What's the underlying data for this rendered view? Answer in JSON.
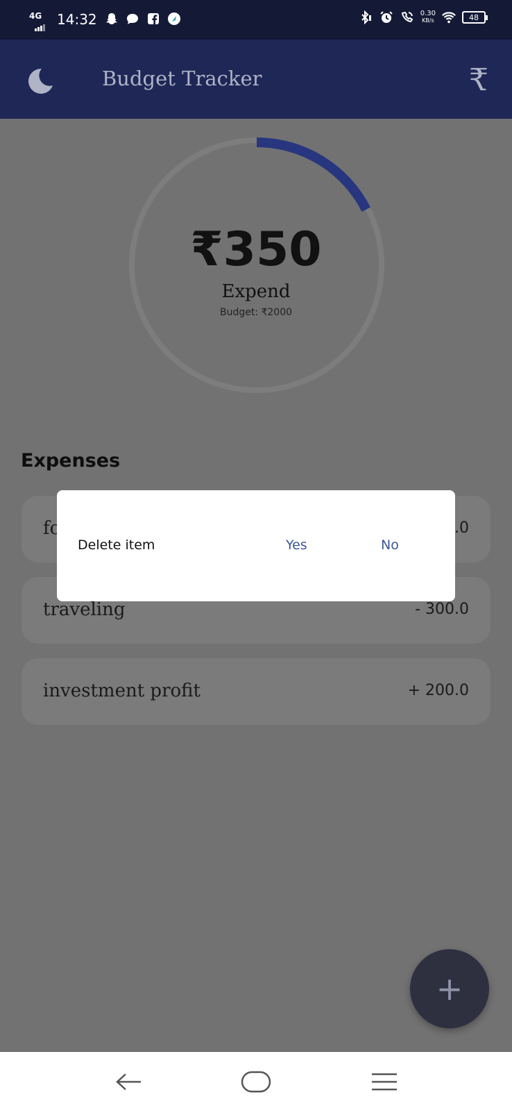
{
  "status_bar": {
    "network": "4G",
    "time": "14:32",
    "speed_value": "0.30",
    "speed_unit": "KB/s",
    "battery": "48",
    "notification_icons": [
      "snapchat-icon",
      "message-icon",
      "facebook-icon",
      "app-icon"
    ],
    "system_icons": [
      "bluetooth-icon",
      "vibrate-icon",
      "alarm-icon",
      "wifi-calling-icon",
      "wifi-icon",
      "battery-icon"
    ]
  },
  "app_bar": {
    "title": "Budget Tracker",
    "theme_icon": "moon-icon",
    "currency_button": "₹"
  },
  "summary": {
    "amount": "₹350",
    "label": "Expend",
    "budget_text": "Budget: ₹2000",
    "progress_fraction": 0.175,
    "progress_color": "#27367f"
  },
  "expenses": {
    "heading": "Expenses",
    "items": [
      {
        "name": "fo",
        "amount": ".0"
      },
      {
        "name": "traveling",
        "amount": "- 300.0"
      },
      {
        "name": "investment profit",
        "amount": "+ 200.0"
      }
    ]
  },
  "dialog": {
    "message": "Delete item",
    "yes_label": "Yes",
    "no_label": "No"
  },
  "fab": {
    "label": "+"
  },
  "nav_bar": {
    "items": [
      "back-icon",
      "home-icon",
      "menu-icon"
    ]
  }
}
